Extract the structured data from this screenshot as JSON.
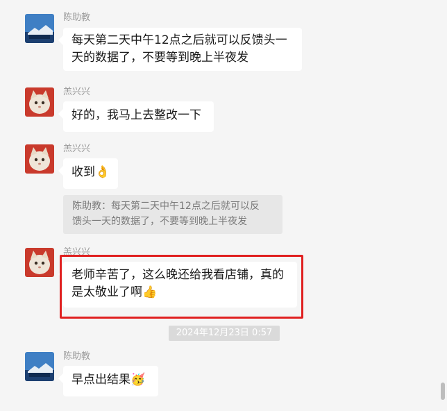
{
  "messages": [
    {
      "name": "陈助教",
      "text": "每天第二天中午12点之后就可以反馈头一天的数据了，不要等到晚上半夜发",
      "line1": "每天第二天中午12点之后就可以反馈头一",
      "line2": "天的数据了，不要等到晚上半夜发"
    },
    {
      "name": "羔兴兴",
      "text": "好的，我马上去整改一下"
    },
    {
      "name": "羔兴兴",
      "text": "收到",
      "emoji": "👌"
    },
    {
      "quote": "陈助教：每天第二天中午12点之后就可以反馈头一天的数据了，不要等到晚上半夜发",
      "quote_line1": "陈助教：每天第二天中午12点之后就可以反",
      "quote_line2": "馈头一天的数据了，不要等到晚上半夜发"
    },
    {
      "name": "羔兴兴",
      "line1": "老师辛苦了，这么晚还给我看店铺，真的",
      "line2": "是太敬业了啊",
      "emoji": "👍"
    },
    {
      "timestamp": "2024年12月23日 0:57"
    },
    {
      "name": "陈助教",
      "text": "早点出结果",
      "emoji": "🥳"
    }
  ],
  "colors": {
    "highlight": "#e02020",
    "background": "#f5f5f5"
  }
}
